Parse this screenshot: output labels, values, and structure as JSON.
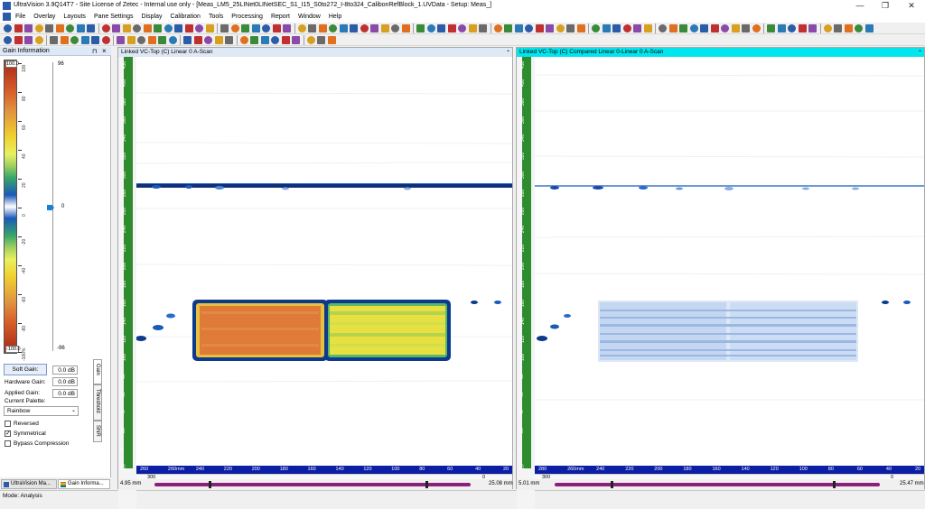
{
  "window": {
    "title": "UltraVision 3.9Q14T7 - Site License of Zetec - Internal use only - [Meas_LM5_25LINet0LINetSEC_S1_I15_S0to272_I-8to324_CalibonRefBlock_1.UVData - Setup: Meas_]",
    "minimize": "—",
    "maximize": "❐",
    "close": "✕"
  },
  "menu": [
    "File",
    "Overlay",
    "Layouts",
    "Pane Settings",
    "Display",
    "Calibration",
    "Tools",
    "Processing",
    "Report",
    "Window",
    "Help"
  ],
  "gain_panel": {
    "header": "Gain Information",
    "pin_icon": "pin-icon",
    "close_icon": "close-icon",
    "palette_top": "100.0",
    "palette_bottom": "-100.0",
    "ruler_top": "96",
    "ruler_mid": "0",
    "ruler_bottom": "-96",
    "ruler_ticks": [
      "100",
      "80",
      "60",
      "40",
      "20",
      "0",
      "-20",
      "-40",
      "-60",
      "-80",
      "-100%"
    ],
    "soft_gain_label": "Soft Gain:",
    "soft_gain_value": "0.0 dB",
    "hardware_gain_label": "Hardware Gain:",
    "hardware_gain_value": "0.0 dB",
    "applied_gain_label": "Applied Gain:",
    "applied_gain_value": "0.0 dB",
    "current_palette_label": "Current Palette:",
    "palette_select": "Rainbow",
    "checkboxes": [
      {
        "label": "Reversed",
        "checked": false
      },
      {
        "label": "Symmetrical",
        "checked": true
      },
      {
        "label": "Bypass Compression",
        "checked": false
      }
    ],
    "side_tabs": [
      "Gain",
      "Threshold",
      "SNR"
    ]
  },
  "bottom_tabs": [
    "UltraVision Ma...",
    "Gain Informa..."
  ],
  "status": {
    "mode": "Mode: Analysis"
  },
  "left_pane": {
    "header": "Linked VC-Top (C) Linear 0 A-Scan",
    "header_color": "#dfe8f5",
    "v_labels": [
      "450",
      "400",
      "380",
      "360",
      "340",
      "320",
      "300",
      "280",
      "260",
      "240",
      "220",
      "200",
      "180",
      "160",
      "140",
      "120",
      "100",
      "80",
      "60",
      "40",
      "20",
      "0",
      "-20"
    ],
    "h_labels": [
      "260",
      "260mm",
      "240",
      "220",
      "200",
      "180",
      "160",
      "140",
      "120",
      "100",
      "80",
      "60",
      "40",
      "20"
    ],
    "h_row2_left": "300",
    "h_row2_right": "0",
    "range_start": "4.95 mm",
    "range_end": "25.08 mm"
  },
  "right_pane": {
    "header": "Linked VC-Top (C) Compared Linear 0-Linear 0 A-Scan",
    "header_color": "#00e5ee",
    "v_labels": [
      "450",
      "400",
      "380",
      "360",
      "340",
      "320",
      "300",
      "280",
      "260",
      "240",
      "220",
      "200",
      "180",
      "160",
      "140",
      "120",
      "100",
      "80",
      "60",
      "40",
      "20",
      "0",
      "-20"
    ],
    "h_labels": [
      "280",
      "260mm",
      "240",
      "220",
      "200",
      "180",
      "160",
      "140",
      "120",
      "100",
      "80",
      "60",
      "40",
      "20"
    ],
    "h_row2_left": "300",
    "h_row2_right": "0",
    "range_start": "5.01 mm",
    "range_end": "25.47 mm"
  }
}
